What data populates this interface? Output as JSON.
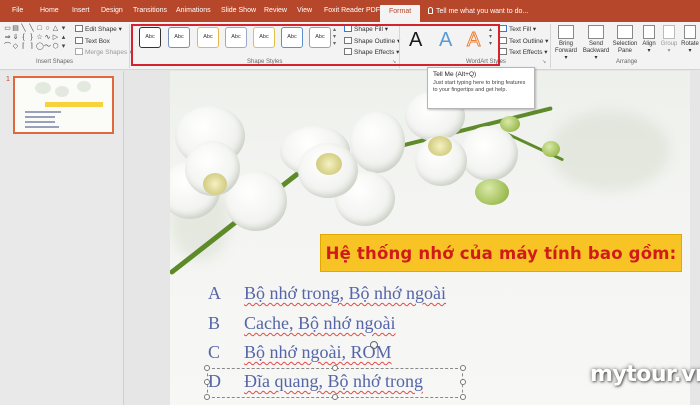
{
  "tabs": [
    "File",
    "Home",
    "Insert",
    "Design",
    "Transitions",
    "Animations",
    "Slide Show",
    "Review",
    "View",
    "Foxit Reader PDF",
    "Format"
  ],
  "tell_me": "Tell me what you want to do...",
  "ribbon": {
    "insert_shapes": {
      "label": "Insert Shapes",
      "edit_shape": "Edit Shape",
      "text_box": "Text Box",
      "merge_shapes": "Merge Shapes"
    },
    "shape_styles": {
      "label": "Shape Styles",
      "swatches": [
        "Abc",
        "Abc",
        "Abc",
        "Abc",
        "Abc",
        "Abc",
        "Abc"
      ],
      "swatch_colors": [
        "#333333",
        "#7a8fb8",
        "#e8b84a",
        "#9aa9c8",
        "#e0c24a",
        "#5a8fd0",
        "#a0a0a0"
      ],
      "shape_fill": "Shape Fill",
      "shape_outline": "Shape Outline",
      "shape_effects": "Shape Effects"
    },
    "wordart_styles": {
      "label": "WordArt Styles",
      "letters": [
        "A",
        "A",
        "A"
      ],
      "letter_colors": [
        "#1a1a1a",
        "#5b9bd5",
        "#ed7d31"
      ],
      "text_fill": "Text Fill",
      "text_outline": "Text Outline",
      "text_effects": "Text Effects"
    },
    "arrange": {
      "label": "Arrange",
      "bring_forward": [
        "Bring",
        "Forward"
      ],
      "send_backward": [
        "Send",
        "Backward"
      ],
      "selection_pane": [
        "Selection",
        "Pane"
      ],
      "align": "Align",
      "group": "Group",
      "rotate": "Rotate"
    }
  },
  "tooltip": {
    "title": "Tell Me (Alt+Q)",
    "text": "Just start typing here to bring features to your fingertips and get help."
  },
  "slide_panel": {
    "slide_number": "1"
  },
  "slide": {
    "title": "Hệ thống nhớ của máy tính bao gồm:",
    "options": [
      {
        "letter": "A",
        "text": "Bộ nhớ trong, Bộ nhớ ngoài"
      },
      {
        "letter": "B",
        "text": "Cache, Bộ nhớ ngoài"
      },
      {
        "letter": "C",
        "text": "Bộ nhớ ngoài, ROM"
      },
      {
        "letter": "D",
        "text": "Đĩa quang, Bộ nhớ trong"
      }
    ]
  },
  "watermark": "mytour.vn",
  "colors": {
    "accent": "#b7472a",
    "highlight_red": "#d4232c",
    "title_bg": "#f7c325",
    "title_text": "#d11b1b",
    "option_text": "#5565a8"
  }
}
